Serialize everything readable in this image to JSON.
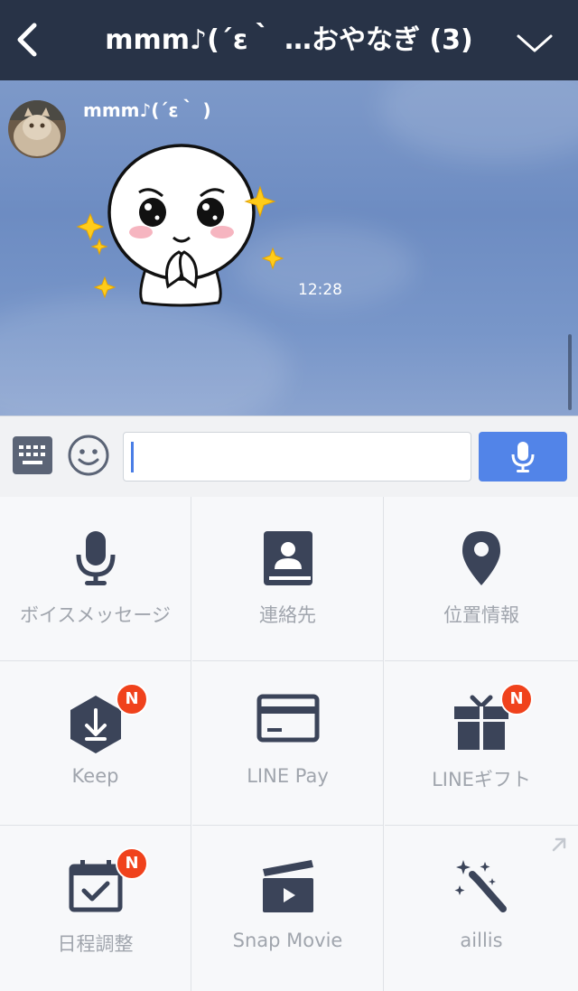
{
  "header": {
    "title": "mmm♪(´ε｀ …おやなぎ (3)"
  },
  "chat": {
    "messages": [
      {
        "sender": "mmm♪(´ε｀ )",
        "type": "sticker",
        "time": "12:28"
      }
    ]
  },
  "input": {
    "value": ""
  },
  "menu": {
    "items": [
      {
        "label": "ボイスメッセージ",
        "icon": "microphone-icon"
      },
      {
        "label": "連絡先",
        "icon": "contacts-book-icon"
      },
      {
        "label": "位置情報",
        "icon": "location-pin-icon"
      },
      {
        "label": "Keep",
        "icon": "keep-download-icon",
        "badge": "N"
      },
      {
        "label": "LINE Pay",
        "icon": "card-icon"
      },
      {
        "label": "LINEギフト",
        "icon": "gift-icon",
        "badge": "N"
      },
      {
        "label": "日程調整",
        "icon": "calendar-check-icon",
        "badge": "N"
      },
      {
        "label": "Snap Movie",
        "icon": "clapperboard-icon"
      },
      {
        "label": "aillis",
        "icon": "magic-wand-icon"
      }
    ]
  },
  "colors": {
    "header_bg": "#283347",
    "icon": "#3b4459",
    "accent": "#5284e8",
    "badge": "#f0421c"
  }
}
